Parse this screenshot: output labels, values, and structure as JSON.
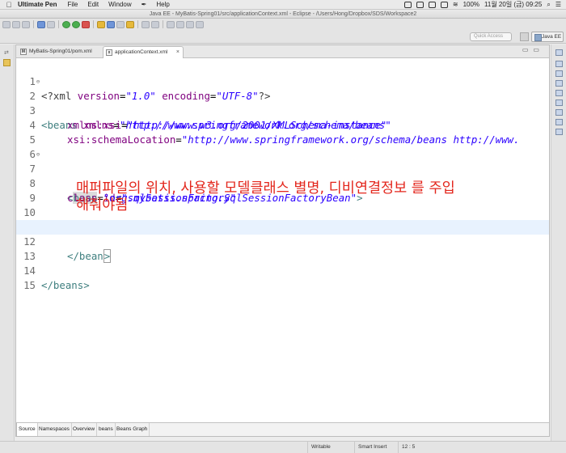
{
  "menubar": {
    "app_name": "Ultimate Pen",
    "items": [
      "File",
      "Edit",
      "Window",
      "Help"
    ],
    "battery": "100%",
    "datetime": "11월 20일 (금)  09:25"
  },
  "window": {
    "title": "Java EE - MyBatis-Spring01/src/applicationContext.xml - Eclipse - /Users/Hong/Dropbox/SDS/Workspace2"
  },
  "toolbar": {
    "quick_access_placeholder": "Quick Access",
    "perspective_label": "Java EE"
  },
  "editor": {
    "tabs": [
      {
        "label": "MyBatis-Spring01/pom.xml",
        "active": false
      },
      {
        "label": "applicationContext.xml",
        "active": true
      }
    ],
    "lines": [
      {
        "num": "1",
        "fold": ""
      },
      {
        "num": "2",
        "fold": "⊖"
      },
      {
        "num": "3",
        "fold": ""
      },
      {
        "num": "4",
        "fold": ""
      },
      {
        "num": "5",
        "fold": ""
      },
      {
        "num": "6",
        "fold": ""
      },
      {
        "num": "7",
        "fold": "⊖"
      },
      {
        "num": "8",
        "fold": ""
      },
      {
        "num": "9",
        "fold": ""
      },
      {
        "num": "10",
        "fold": ""
      },
      {
        "num": "11",
        "fold": ""
      },
      {
        "num": "12",
        "fold": ""
      },
      {
        "num": "13",
        "fold": ""
      },
      {
        "num": "14",
        "fold": ""
      },
      {
        "num": "15",
        "fold": ""
      }
    ],
    "code": {
      "l1_open": "<?xml ",
      "l1_attr1": "version",
      "l1_eq1": "=",
      "l1_val1": "\"1.0\"",
      "l1_attr2": " encoding",
      "l1_eq2": "=",
      "l1_val2": "\"UTF-8\"",
      "l1_close": "?>",
      "l2_tag": "<beans ",
      "l2_attr": "xmlns",
      "l2_eq": "=",
      "l2_val": "\"http://www.springframework.org/schema/beans\"",
      "l3_attr": "xmlns:xsi",
      "l3_eq": "=",
      "l3_val": "\"http://www.w3.org/2001/XMLSchema-instance\"",
      "l4_attr": "xsi:schemaLocation",
      "l4_eq": "=",
      "l4_val": "\"http://www.springframework.org/schema/beans http://www.",
      "l7_lt": "<",
      "l7_tag": "bean",
      "l7_attr": " id",
      "l7_eq": "=",
      "l7_val": "\"sqlSessionFactory\"",
      "l8_attr": "class",
      "l8_eq": "=",
      "l8_val": "\"org.mybatis.spring.SqlSessionFactoryBean\"",
      "l8_close": ">",
      "l12_tag": "</bean",
      "l12_close": ">",
      "l14_tag": "</beans>"
    },
    "annotation_line1": "매퍼파일의 위치, 사용할 모델클래스 별명, 디비연결정보 를 주입",
    "annotation_line2": "해줘야됨",
    "bottom_tabs": [
      "Source",
      "Namespaces",
      "Overview",
      "beans",
      "Beans Graph"
    ]
  },
  "status": {
    "writable": "Writable",
    "insert_mode": "Smart Insert",
    "position": "12 : 5"
  }
}
